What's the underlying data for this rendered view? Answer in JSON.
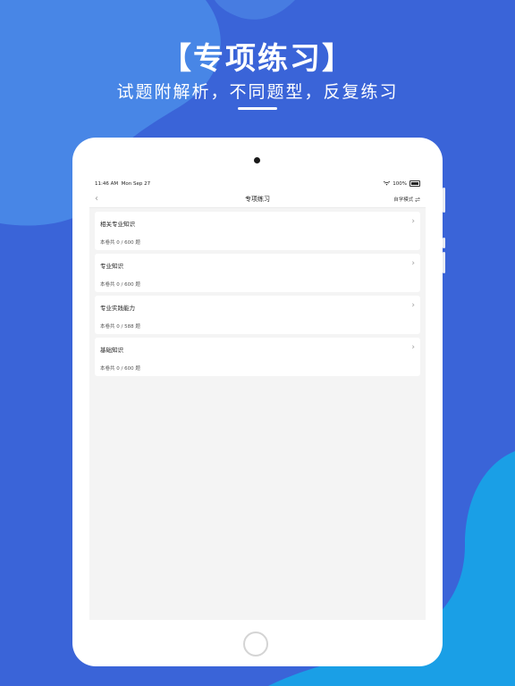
{
  "promo": {
    "title": "【专项练习】",
    "subtitle": "试题附解析，不同题型，反复练习"
  },
  "status_bar": {
    "time": "11:46 AM",
    "date": "Mon Sep 27",
    "battery": "100%"
  },
  "nav": {
    "back_icon": "chevron-left-icon",
    "title": "专项练习",
    "mode_label": "自学模式"
  },
  "list": {
    "items": [
      {
        "title": "相关专业知识",
        "count": "本卷共 0 / 600 题"
      },
      {
        "title": "专业知识",
        "count": "本卷共 0 / 600 题"
      },
      {
        "title": "专业实践能力",
        "count": "本卷共 0 / 588 题"
      },
      {
        "title": "基础知识",
        "count": "本卷共 0 / 600 题"
      }
    ]
  },
  "colors": {
    "background": "#3a64d8",
    "blob_light": "#4a8ae8",
    "blob_cyan": "#1a9fe6"
  }
}
